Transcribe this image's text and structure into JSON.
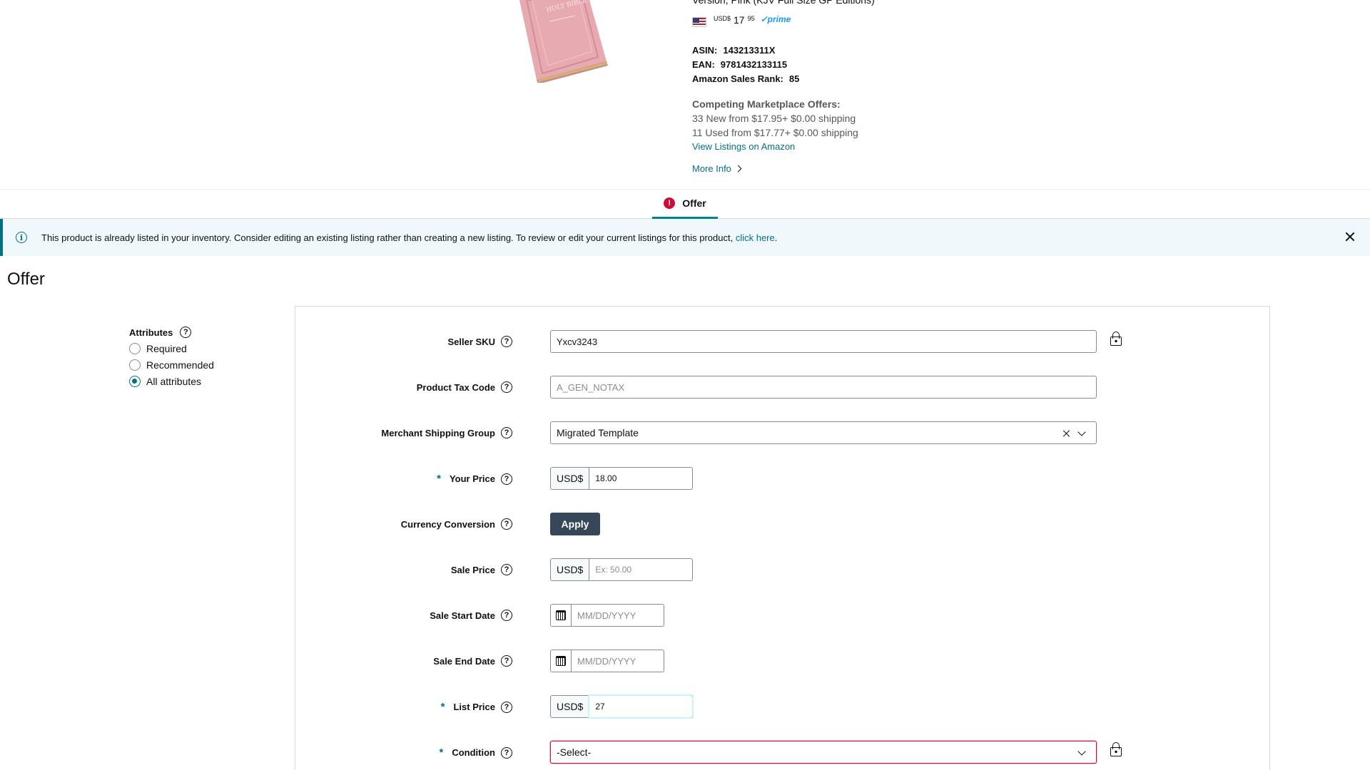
{
  "product": {
    "title_fragment": "Version, Pink (KJV Full Size GP Editions)",
    "currency_small": "USD$",
    "price_whole": "17",
    "price_fraction": "95",
    "prime_label": "✓prime",
    "asin_label": "ASIN:",
    "asin_value": "143213311X",
    "ean_label": "EAN:",
    "ean_value": "9781432133115",
    "rank_label": "Amazon Sales Rank:",
    "rank_value": "85",
    "competing_heading": "Competing Marketplace Offers:",
    "new_offers": "33 New  from $17.95+ $0.00 shipping",
    "used_offers": "11 Used  from $17.77+ $0.00 shipping",
    "view_listings": "View Listings on Amazon",
    "more_info": "More Info",
    "book_text": "HOLY BIBLE"
  },
  "tabs": [
    {
      "label": "Offer",
      "active": true,
      "has_error": true
    }
  ],
  "alert": {
    "text": "This product is already listed in your inventory. Consider editing an existing listing rather than creating a new listing. To review or edit your current listings for this product, ",
    "link": "click here",
    "suffix": "."
  },
  "page_title": "Offer",
  "attributes_filter": {
    "title": "Attributes",
    "options": [
      "Required",
      "Recommended",
      "All attributes"
    ],
    "selected": "All attributes"
  },
  "form": {
    "seller_sku": {
      "label": "Seller SKU",
      "value": "Yxcv3243"
    },
    "product_tax_code": {
      "label": "Product Tax Code",
      "placeholder": "A_GEN_NOTAX"
    },
    "shipping_group": {
      "label": "Merchant Shipping Group",
      "value": "Migrated Template"
    },
    "your_price": {
      "label": "Your Price",
      "currency": "USD$",
      "value": "18.00"
    },
    "currency_conversion": {
      "label": "Currency Conversion",
      "button": "Apply"
    },
    "sale_price": {
      "label": "Sale Price",
      "currency": "USD$",
      "placeholder": "Ex: 50.00"
    },
    "sale_start_date": {
      "label": "Sale Start Date",
      "placeholder": "MM/DD/YYYY"
    },
    "sale_end_date": {
      "label": "Sale End Date",
      "placeholder": "MM/DD/YYYY"
    },
    "list_price": {
      "label": "List Price",
      "currency": "USD$",
      "value": "27"
    },
    "condition": {
      "label": "Condition",
      "value": "-Select-"
    },
    "required_mark": "*",
    "help_glyph": "?"
  },
  "colors": {
    "accent": "#007185",
    "error": "#cc0c39",
    "button_dark": "#37475a",
    "alert_bg": "#f0f8fb",
    "book_pink": "#e7aab0"
  }
}
